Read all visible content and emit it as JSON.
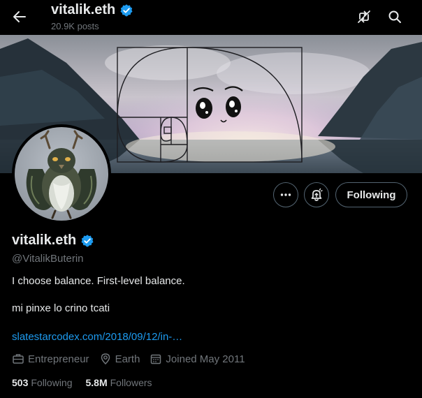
{
  "header": {
    "name": "vitalik.eth",
    "posts": "20.9K posts"
  },
  "profile": {
    "name": "vitalik.eth",
    "handle": "@VitalikButerin",
    "bio_line1": "I choose balance. First-level balance.",
    "bio_line2": "mi pinxe lo crino tcati",
    "link": "slatestarcodex.com/2018/09/12/in-…",
    "profession": "Entrepreneur",
    "location": "Earth",
    "joined": "Joined May 2011",
    "following_count": "503",
    "following_label": "Following",
    "followers_count": "5.8M",
    "followers_label": "Followers"
  },
  "actions": {
    "following_button": "Following"
  },
  "colors": {
    "accent": "#1d9bf0",
    "text": "#e7e9ea",
    "muted": "#71767b",
    "border": "#536471",
    "background": "#000000"
  },
  "icons": [
    "back-arrow-icon",
    "verified-badge-icon",
    "no-retweets-icon",
    "search-icon",
    "more-icon",
    "notification-bell-icon",
    "briefcase-icon",
    "location-pin-icon",
    "calendar-icon"
  ]
}
